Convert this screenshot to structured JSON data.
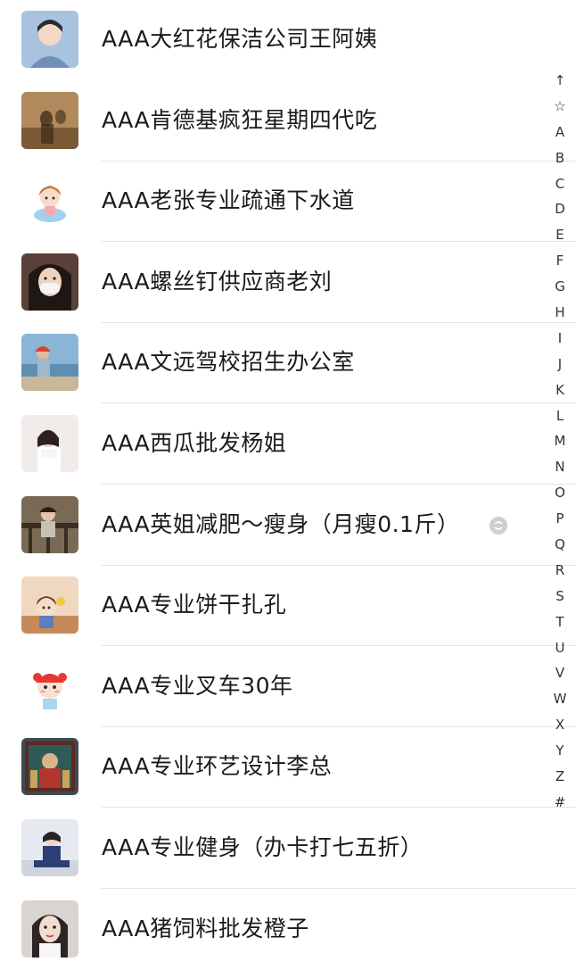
{
  "contacts": [
    {
      "name": "AAA大红花保洁公司王阿姨",
      "avatar": "avatar-boy-portrait"
    },
    {
      "name": "AAA肯德基疯狂星期四代吃",
      "avatar": "avatar-shadow-photo"
    },
    {
      "name": "AAA老张专业疏通下水道",
      "avatar": "avatar-cartoon-girl"
    },
    {
      "name": "AAA螺丝钉供应商老刘",
      "avatar": "avatar-masked-girl"
    },
    {
      "name": "AAA文远驾校招生办公室",
      "avatar": "avatar-beach-girl"
    },
    {
      "name": "AAA西瓜批发杨姐",
      "avatar": "avatar-white-girl"
    },
    {
      "name": "AAA英姐减肥～瘦身（月瘦0.1斤）",
      "avatar": "avatar-fence-girl",
      "badge": "status-icon"
    },
    {
      "name": "AAA专业饼干扎孔",
      "avatar": "avatar-cartoon-child"
    },
    {
      "name": "AAA专业叉车30年",
      "avatar": "avatar-cartoon-red-hat"
    },
    {
      "name": "AAA专业环艺设计李总",
      "avatar": "avatar-temple-art"
    },
    {
      "name": "AAA专业健身（办卡打七五折）",
      "avatar": "avatar-sitting-girl"
    },
    {
      "name": "AAA猪饲料批发橙子",
      "avatar": "avatar-illustrated-girl"
    }
  ],
  "index_bar": [
    "↑",
    "☆",
    "A",
    "B",
    "C",
    "D",
    "E",
    "F",
    "G",
    "H",
    "I",
    "J",
    "K",
    "L",
    "M",
    "N",
    "O",
    "P",
    "Q",
    "R",
    "S",
    "T",
    "U",
    "V",
    "W",
    "X",
    "Y",
    "Z",
    "#"
  ]
}
